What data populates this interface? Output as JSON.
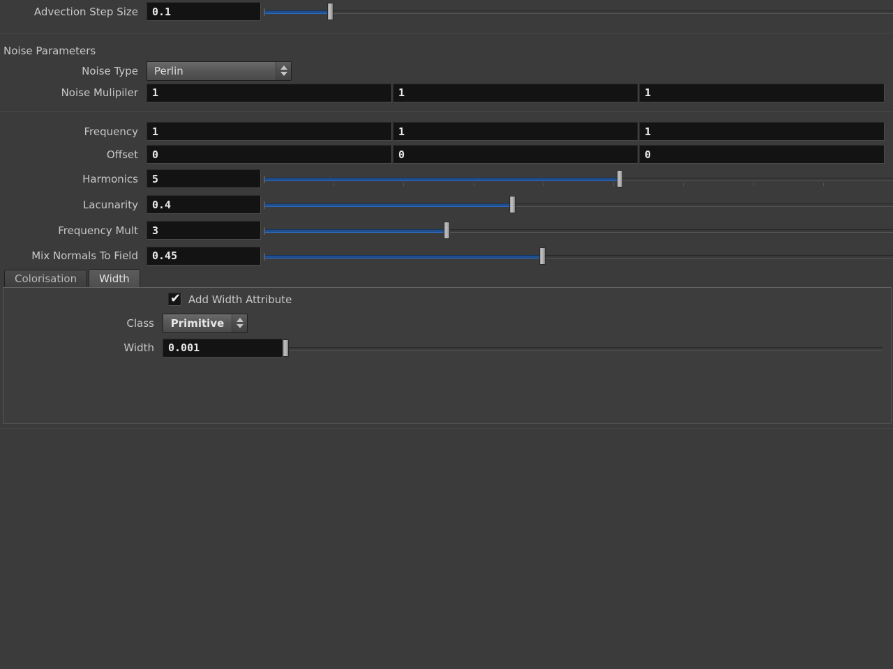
{
  "advection": {
    "label": "Advection Step Size",
    "value": "0.1",
    "slider": {
      "fill_pct": 10.5,
      "handle_pct": 10.5
    }
  },
  "noise_section": {
    "title": "Noise Parameters",
    "noise_type": {
      "label": "Noise Type",
      "value": "Perlin"
    },
    "noise_multiplier": {
      "label": "Noise Mulipiler",
      "values": [
        "1",
        "1",
        "1"
      ]
    }
  },
  "noise_params": {
    "frequency": {
      "label": "Frequency",
      "values": [
        "1",
        "1",
        "1"
      ]
    },
    "offset": {
      "label": "Offset",
      "values": [
        "0",
        "0",
        "0"
      ]
    },
    "harmonics": {
      "label": "Harmonics",
      "value": "5",
      "slider": {
        "fill_pct": 56.5,
        "handle_pct": 56.5,
        "ticks": 8
      }
    },
    "lacunarity": {
      "label": "Lacunarity",
      "value": "0.4",
      "slider": {
        "fill_pct": 39.5,
        "handle_pct": 39.5
      }
    },
    "frequency_mult": {
      "label": "Frequency Mult",
      "value": "3",
      "slider": {
        "fill_pct": 29.0,
        "handle_pct": 29.0
      }
    },
    "mix_normals": {
      "label": "Mix Normals To Field",
      "value": "0.45",
      "slider": {
        "fill_pct": 44.2,
        "handle_pct": 44.2
      }
    }
  },
  "tabs": {
    "items": [
      {
        "label": "Colorisation",
        "active": false
      },
      {
        "label": "Width",
        "active": true
      }
    ]
  },
  "width_panel": {
    "add_width_attribute": {
      "label": "Add Width Attribute",
      "checked": true,
      "check_glyph": "✔"
    },
    "class": {
      "label": "Class",
      "value": "Primitive"
    },
    "width": {
      "label": "Width",
      "value": "0.001",
      "slider": {
        "fill_pct": 0.0,
        "handle_pct": 0.0
      }
    }
  },
  "colors": {
    "background": "#3b3b3b",
    "field_bg": "#131313",
    "slider_blue": "#1f4f8f",
    "text": "#c8c8c8",
    "value_text": "#e8e8e8"
  }
}
